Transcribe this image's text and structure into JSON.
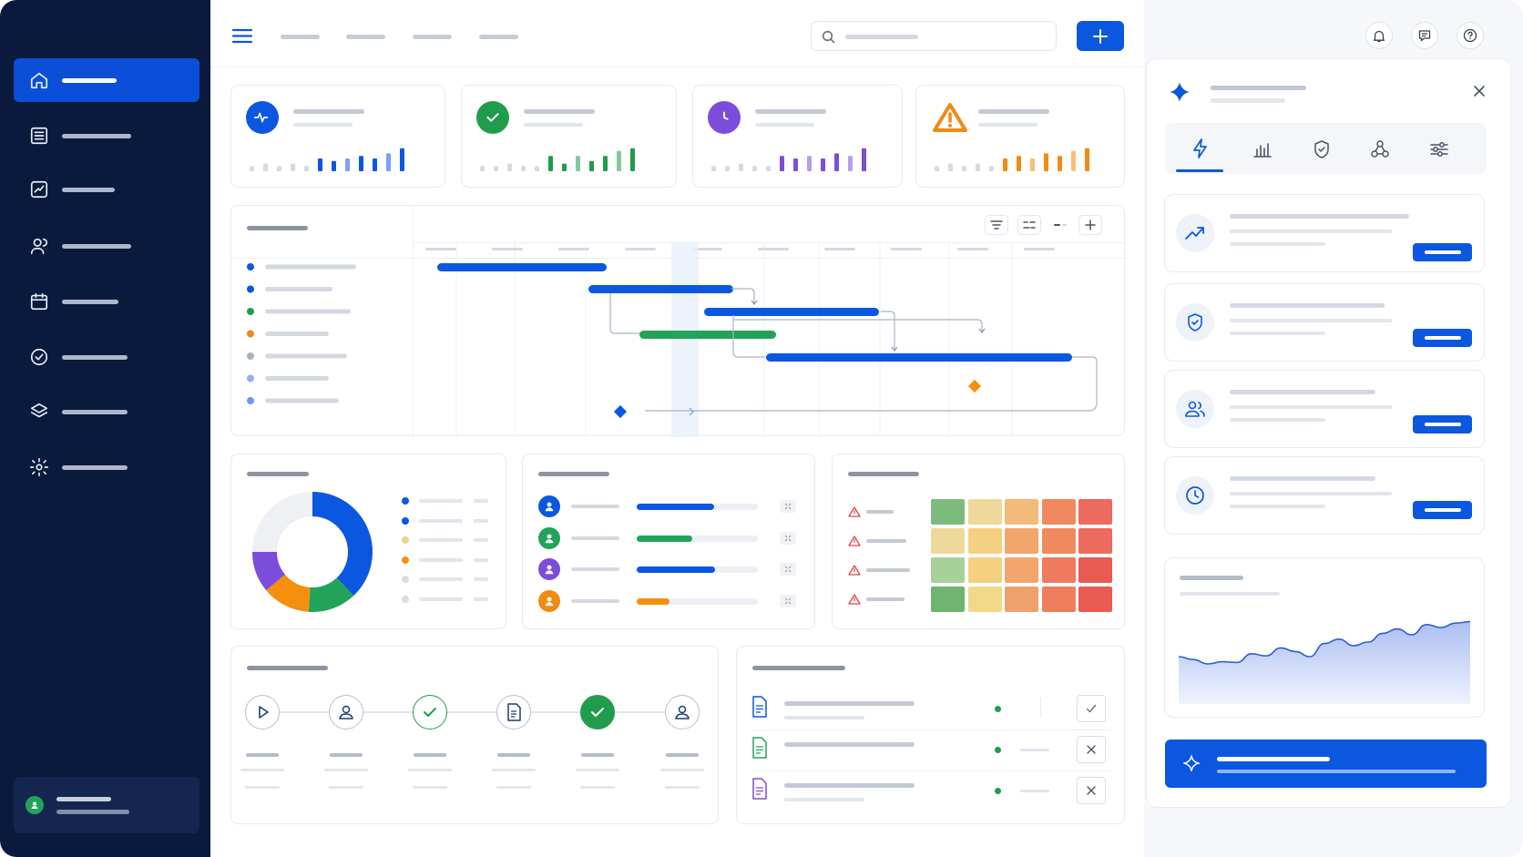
{
  "sidebar": {
    "items": [
      {
        "icon": "home-icon",
        "active": true
      },
      {
        "icon": "list-icon",
        "active": false
      },
      {
        "icon": "chart-icon",
        "active": false
      },
      {
        "icon": "users-icon",
        "active": false
      },
      {
        "icon": "calendar-icon",
        "active": false
      },
      {
        "icon": "check-circle-icon",
        "active": false
      },
      {
        "icon": "layers-icon",
        "active": false
      },
      {
        "icon": "gear-icon",
        "active": false
      }
    ]
  },
  "header": {
    "actions": [
      "menu-icon",
      "search-icon",
      "add-icon",
      "bell-icon",
      "chat-icon",
      "help-icon"
    ]
  },
  "kpi_cards": [
    {
      "icon": "activity-icon",
      "color": "#0b57e0",
      "bars": [
        2,
        3,
        2,
        3,
        2,
        5,
        4,
        5,
        6,
        5,
        7,
        9
      ]
    },
    {
      "icon": "check-icon",
      "color": "#1f9d4c",
      "bars": [
        2,
        2,
        3,
        2,
        2,
        6,
        3,
        6,
        4,
        6,
        8,
        9
      ]
    },
    {
      "icon": "clock-icon",
      "color": "#7c4ddb",
      "bars": [
        2,
        2,
        3,
        2,
        2,
        6,
        5,
        6,
        5,
        7,
        6,
        9
      ]
    },
    {
      "icon": "warning-icon",
      "color": "#f08a12",
      "bars": [
        2,
        3,
        2,
        3,
        2,
        5,
        6,
        5,
        7,
        6,
        8,
        9
      ]
    }
  ],
  "gantt": {
    "row_colors": [
      "#0b57e0",
      "#0b57e0",
      "#1f9d4c",
      "#f08a12",
      "#a6b0c0",
      "#8fb0f0",
      "#6f96ee"
    ],
    "toolbar": [
      "filter-icon",
      "view-icon",
      "expand-icon",
      "add-icon"
    ]
  },
  "donut": {
    "segments": [
      {
        "value": 38,
        "color": "#0b57e0"
      },
      {
        "value": 13,
        "color": "#22a35a"
      },
      {
        "value": 13,
        "color": "#f5900f"
      },
      {
        "value": 11,
        "color": "#7c4ddb"
      },
      {
        "value": 25,
        "color": "#eef0f4"
      }
    ],
    "legend_colors": [
      "#0b57e0",
      "#0b57e0",
      "#e9d58a",
      "#f5900f",
      "#d8dde6",
      "#d8dde6"
    ]
  },
  "team": {
    "members": [
      {
        "color": "#0b57e0",
        "progress": 0.64
      },
      {
        "color": "#22a35a",
        "progress": 0.46
      },
      {
        "color": "#7c4ddb",
        "progress": 0.65
      },
      {
        "color": "#f08a12",
        "progress": 0.27
      }
    ],
    "bar_colors": [
      "#0b57e0",
      "#22a35a",
      "#0b57e0",
      "#f5900f"
    ]
  },
  "heatmap": {
    "rows": [
      [
        "#7dbb7d",
        "#eed99a",
        "#f2b97a",
        "#f08a5e",
        "#ec6a5e"
      ],
      [
        "#eed99a",
        "#f5d080",
        "#f2a66c",
        "#ef8a5e",
        "#ec6a5e"
      ],
      [
        "#a6d29a",
        "#f5d080",
        "#f2a66c",
        "#ef7a5e",
        "#e85a52"
      ],
      [
        "#6fb46f",
        "#f2d88a",
        "#f0a06a",
        "#ee7e5e",
        "#e85a52"
      ]
    ]
  },
  "workflow": {
    "steps": [
      {
        "icon": "play-icon",
        "state": "default"
      },
      {
        "icon": "user-icon",
        "state": "default"
      },
      {
        "icon": "check-icon",
        "state": "done-outline"
      },
      {
        "icon": "document-icon",
        "state": "default"
      },
      {
        "icon": "check-icon",
        "state": "done"
      },
      {
        "icon": "user-icon",
        "state": "default"
      }
    ]
  },
  "documents": [
    {
      "icon": "document-icon",
      "color": "#0b57e0",
      "action": "check-icon"
    },
    {
      "icon": "document-icon",
      "color": "#22a35a",
      "action": "close-icon"
    },
    {
      "icon": "document-icon",
      "color": "#7c4ddb",
      "action": "close-icon"
    }
  ],
  "assistant": {
    "tabs": [
      "bolt-icon",
      "bar-chart-icon",
      "shield-icon",
      "network-icon",
      "sliders-icon"
    ],
    "active_tab": 0,
    "suggestions": [
      "trend-up-icon",
      "shield-icon",
      "users-icon",
      "clock-icon"
    ],
    "trend": [
      40,
      36,
      30,
      33,
      32,
      44,
      41,
      52,
      47,
      40,
      58,
      64,
      55,
      60,
      72,
      78,
      70,
      84,
      80,
      86,
      88
    ]
  }
}
